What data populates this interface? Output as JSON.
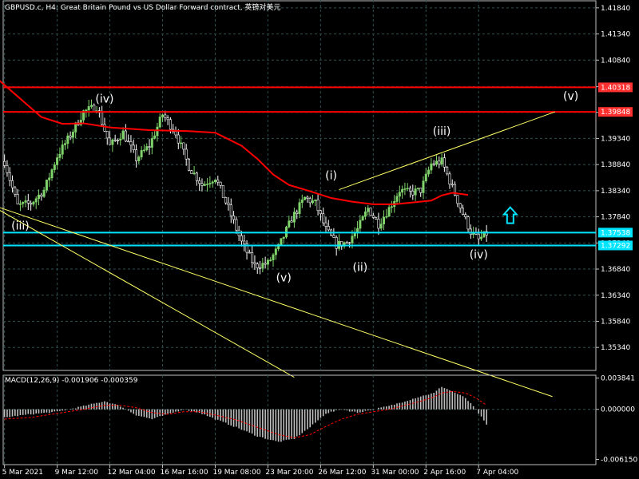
{
  "header": {
    "title": "GBPUSD.c, H4:  Great Britain Pound vs US Dollar Forward contract, 英镑对美元"
  },
  "colors": {
    "background": "#000000",
    "grid": "#2f4f4f",
    "bull_candle": "#7fd36a",
    "bear_candle": "#ffffff",
    "moving_average": "#ff0000",
    "horizontal_red": "#ff0000",
    "horizontal_cyan": "#00e5ff",
    "trendline": "#ffff66",
    "macd_histogram": "#c0c0c0",
    "macd_signal": "#ff0000",
    "arrow": "#00e5ff",
    "tag_red": "#ff3030",
    "tag_cyan": "#00e5ff"
  },
  "icons": {
    "signal_arrow": "up-arrow-outline-icon"
  },
  "chart_data": [
    {
      "type": "candlestick",
      "symbol": "GBPUSD.c",
      "timeframe": "H4",
      "ylim": [
        1.349,
        1.4199
      ],
      "y_ticks": [
        "1.41840",
        "1.41340",
        "1.40840",
        "1.40330",
        "1.39840",
        "1.39340",
        "1.38840",
        "1.38340",
        "1.37840",
        "1.37340",
        "1.36840",
        "1.36340",
        "1.35840",
        "1.35340"
      ],
      "x_ticks": [
        "5 Mar 2021",
        "9 Mar 12:00",
        "12 Mar 04:00",
        "16 Mar 16:00",
        "19 Mar 08:00",
        "23 Mar 20:00",
        "26 Mar 12:00",
        "31 Mar 00:00",
        "2 Apr 16:00",
        "7 Apr 04:00"
      ],
      "close_path": [
        [
          0,
          1.389
        ],
        [
          5,
          1.3805
        ],
        [
          10,
          1.381
        ],
        [
          15,
          1.3835
        ],
        [
          20,
          1.39
        ],
        [
          25,
          1.394
        ],
        [
          30,
          1.3985
        ],
        [
          35,
          1.3995
        ],
        [
          40,
          1.392
        ],
        [
          45,
          1.3945
        ],
        [
          50,
          1.3895
        ],
        [
          55,
          1.392
        ],
        [
          60,
          1.398
        ],
        [
          65,
          1.3945
        ],
        [
          70,
          1.388
        ],
        [
          75,
          1.3845
        ],
        [
          80,
          1.386
        ],
        [
          85,
          1.38
        ],
        [
          90,
          1.3735
        ],
        [
          95,
          1.369
        ],
        [
          100,
          1.3695
        ],
        [
          104,
          1.3725
        ],
        [
          109,
          1.378
        ],
        [
          114,
          1.382
        ],
        [
          118,
          1.381
        ],
        [
          122,
          1.376
        ],
        [
          126,
          1.373
        ],
        [
          130,
          1.3735
        ],
        [
          134,
          1.376
        ],
        [
          138,
          1.38
        ],
        [
          142,
          1.377
        ],
        [
          146,
          1.38
        ],
        [
          150,
          1.3835
        ],
        [
          154,
          1.383
        ],
        [
          158,
          1.3835
        ],
        [
          162,
          1.3885
        ],
        [
          166,
          1.389
        ],
        [
          170,
          1.384
        ],
        [
          174,
          1.379
        ],
        [
          177,
          1.3755
        ],
        [
          180,
          1.374
        ],
        [
          183,
          1.3752
        ]
      ],
      "volatility": 0.0016,
      "moving_average": [
        [
          -2,
          1.4045
        ],
        [
          6,
          1.401
        ],
        [
          14,
          1.3975
        ],
        [
          22,
          1.3962
        ],
        [
          30,
          1.3963
        ],
        [
          40,
          1.3955
        ],
        [
          55,
          1.395
        ],
        [
          70,
          1.3948
        ],
        [
          80,
          1.3945
        ],
        [
          90,
          1.392
        ],
        [
          96,
          1.3895
        ],
        [
          102,
          1.3865
        ],
        [
          108,
          1.3845
        ],
        [
          116,
          1.3833
        ],
        [
          124,
          1.382
        ],
        [
          132,
          1.3813
        ],
        [
          140,
          1.3808
        ],
        [
          148,
          1.3808
        ],
        [
          156,
          1.3812
        ],
        [
          162,
          1.3815
        ],
        [
          166,
          1.3825
        ],
        [
          170,
          1.383
        ],
        [
          176,
          1.3826
        ]
      ],
      "horizontal_lines": [
        {
          "price": 1.40318,
          "label": "1.40318",
          "color": "red"
        },
        {
          "price": 1.39848,
          "label": "1.39848",
          "color": "red"
        },
        {
          "price": 1.37538,
          "label": "1.37538",
          "color": "cyan"
        },
        {
          "price": 1.37292,
          "label": "1.37292",
          "color": "cyan"
        }
      ],
      "trendlines": [
        {
          "from": [
            -2,
            1.3802
          ],
          "to": [
            208,
            1.344
          ]
        },
        {
          "from": [
            -2,
            1.3797
          ],
          "to": [
            110,
            1.3477
          ]
        },
        {
          "from": [
            127,
            1.3836
          ],
          "to": [
            209,
            1.3985
          ]
        }
      ],
      "wave_labels": [
        {
          "text": "(iv)",
          "x": 38,
          "price": 1.4003
        },
        {
          "text": "(iii)",
          "x": 6,
          "price": 1.376
        },
        {
          "text": "(v)",
          "x": 106,
          "price": 1.366
        },
        {
          "text": "(i)",
          "x": 124,
          "price": 1.3856
        },
        {
          "text": "(ii)",
          "x": 135,
          "price": 1.368
        },
        {
          "text": "(iii)",
          "x": 166,
          "price": 1.3941
        },
        {
          "text": "(iv)",
          "x": 180,
          "price": 1.3705
        },
        {
          "text": "(v)",
          "x": 215,
          "price": 1.4008
        }
      ],
      "arrow": {
        "x": 192,
        "price": 1.3787
      }
    },
    {
      "type": "bar",
      "title": "MACD(12,26,9) -0.001906 -0.000359",
      "ylim": [
        -0.00679,
        0.00419
      ],
      "y_ticks": [
        "0.003841",
        "0.000000",
        "-0.006150"
      ],
      "histogram": [
        [
          0,
          -0.001
        ],
        [
          10,
          -0.0006
        ],
        [
          20,
          -0.0003
        ],
        [
          30,
          0.0004
        ],
        [
          38,
          0.001
        ],
        [
          44,
          0.0004
        ],
        [
          50,
          -0.0007
        ],
        [
          56,
          -0.0012
        ],
        [
          62,
          -0.0006
        ],
        [
          68,
          0.0
        ],
        [
          74,
          -0.0004
        ],
        [
          80,
          -0.0012
        ],
        [
          88,
          -0.0022
        ],
        [
          96,
          -0.0033
        ],
        [
          104,
          -0.004
        ],
        [
          110,
          -0.0036
        ],
        [
          116,
          -0.0022
        ],
        [
          122,
          -0.0005
        ],
        [
          128,
          0.0
        ],
        [
          134,
          -0.0004
        ],
        [
          140,
          0.0
        ],
        [
          146,
          0.0004
        ],
        [
          152,
          0.001
        ],
        [
          158,
          0.0016
        ],
        [
          163,
          0.002
        ],
        [
          166,
          0.0028
        ],
        [
          170,
          0.0022
        ],
        [
          175,
          0.0014
        ],
        [
          179,
          0.0
        ],
        [
          183,
          -0.0019
        ]
      ],
      "signal": [
        [
          0,
          -0.0012
        ],
        [
          10,
          -0.001
        ],
        [
          20,
          -0.0005
        ],
        [
          30,
          0.0
        ],
        [
          38,
          0.0005
        ],
        [
          44,
          0.0005
        ],
        [
          50,
          0.0002
        ],
        [
          56,
          -0.0004
        ],
        [
          62,
          -0.0006
        ],
        [
          68,
          -0.0003
        ],
        [
          74,
          -0.0003
        ],
        [
          80,
          -0.0007
        ],
        [
          88,
          -0.0013
        ],
        [
          96,
          -0.0022
        ],
        [
          104,
          -0.0031
        ],
        [
          110,
          -0.0035
        ],
        [
          116,
          -0.0031
        ],
        [
          122,
          -0.0021
        ],
        [
          128,
          -0.0012
        ],
        [
          134,
          -0.0006
        ],
        [
          140,
          -0.0003
        ],
        [
          146,
          0.0
        ],
        [
          152,
          0.0005
        ],
        [
          158,
          0.001
        ],
        [
          163,
          0.0015
        ],
        [
          166,
          0.002
        ],
        [
          170,
          0.0022
        ],
        [
          175,
          0.002
        ],
        [
          179,
          0.0014
        ],
        [
          183,
          0.0005
        ]
      ]
    }
  ]
}
